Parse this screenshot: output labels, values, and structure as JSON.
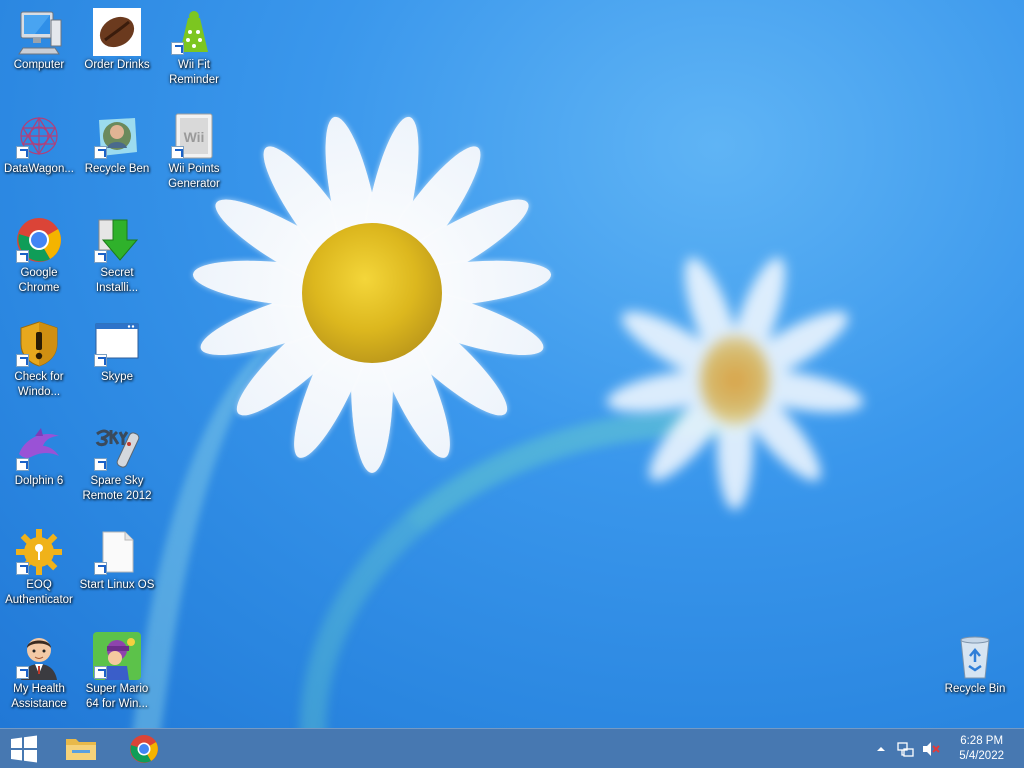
{
  "desktop_icons": [
    {
      "name": "Computer",
      "icon": "computer-icon"
    },
    {
      "name": "Order Drinks",
      "icon": "coffee-bean-icon"
    },
    {
      "name": "Wii Fit Reminder",
      "icon": "wii-fit-icon"
    },
    {
      "name": "DataWagon...",
      "icon": "network-graph-icon"
    },
    {
      "name": "Recycle Ben",
      "icon": "ben-photo-icon"
    },
    {
      "name": "Wii Points Generator",
      "icon": "wii-icon"
    },
    {
      "name": "Google Chrome",
      "icon": "chrome-icon"
    },
    {
      "name": "Secret Installi...",
      "icon": "green-arrow-installer-icon"
    },
    {
      "name": "Check for Windo...",
      "icon": "shield-warning-icon"
    },
    {
      "name": "Skype",
      "icon": "window-icon"
    },
    {
      "name": "Dolphin 6",
      "icon": "dolphin-icon"
    },
    {
      "name": "Spare Sky Remote 2012",
      "icon": "sky-remote-icon"
    },
    {
      "name": "EOQ Authenticator",
      "icon": "gear-key-icon"
    },
    {
      "name": "Start Linux OS",
      "icon": "blank-file-icon"
    },
    {
      "name": "My Health Assistance",
      "icon": "doctor-avatar-icon"
    },
    {
      "name": "Super Mario 64 for Win...",
      "icon": "mario-icon"
    },
    {
      "name": "Recycle Bin",
      "icon": "recycle-bin-icon"
    }
  ],
  "taskbar": {
    "start": "windows-logo-icon",
    "pinned": [
      "file-explorer-icon",
      "chrome-icon"
    ],
    "tray": {
      "overflow": "chevron-up-icon",
      "network": "network-icon",
      "volume": "speaker-muted-icon"
    },
    "clock": {
      "time": "6:28 PM",
      "date": "5/4/2022"
    }
  },
  "colors": {
    "desktop_blue": "#2a86e0",
    "taskbar": "#1e5aa0",
    "chrome_red": "#db4437",
    "chrome_green": "#0f9d58",
    "chrome_yellow": "#f4b400",
    "chrome_blue": "#4285f4"
  }
}
